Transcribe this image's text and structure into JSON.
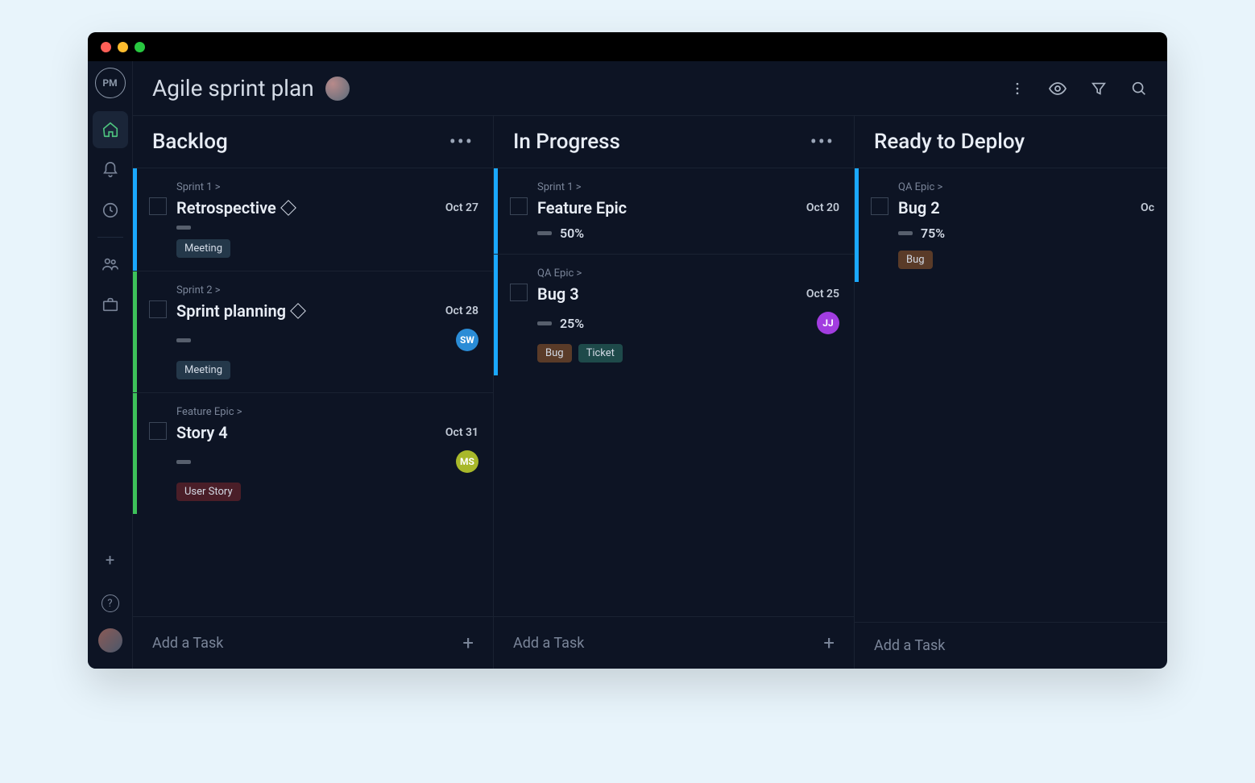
{
  "window": {
    "logo_text": "PM",
    "title": "Agile sprint plan"
  },
  "topbar_icons": {
    "more": "more-vertical-icon",
    "eye": "eye-icon",
    "filter": "filter-icon",
    "search": "search-icon"
  },
  "sidebar": {
    "items": [
      "home",
      "notifications",
      "recent",
      "people",
      "projects"
    ],
    "bottom": [
      "add",
      "help",
      "user-avatar"
    ]
  },
  "columns": [
    {
      "title": "Backlog",
      "show_more": true,
      "cards": [
        {
          "stripe": "blue",
          "breadcrumb": "Sprint 1 >",
          "title": "Retrospective",
          "has_diamond": true,
          "date": "Oct 27",
          "percent": "",
          "avatar": null,
          "tags": [
            {
              "label": "Meeting",
              "cls": "tag-meeting"
            }
          ]
        },
        {
          "stripe": "green",
          "breadcrumb": "Sprint 2 >",
          "title": "Sprint planning",
          "has_diamond": true,
          "date": "Oct 28",
          "percent": "",
          "avatar": {
            "text": "SW",
            "bg": "#2a8cd6"
          },
          "tags": [
            {
              "label": "Meeting",
              "cls": "tag-meeting"
            }
          ]
        },
        {
          "stripe": "green",
          "breadcrumb": "Feature Epic >",
          "title": "Story 4",
          "has_diamond": false,
          "date": "Oct 31",
          "percent": "",
          "avatar": {
            "text": "MS",
            "bg": "#a8b82a"
          },
          "tags": [
            {
              "label": "User Story",
              "cls": "tag-userstory"
            }
          ]
        }
      ],
      "add_task_label": "Add a Task",
      "show_add_plus": true
    },
    {
      "title": "In Progress",
      "show_more": true,
      "cards": [
        {
          "stripe": "blue",
          "breadcrumb": "Sprint 1 >",
          "title": "Feature Epic",
          "has_diamond": false,
          "date": "Oct 20",
          "percent": "50%",
          "avatar": null,
          "tags": []
        },
        {
          "stripe": "blue",
          "breadcrumb": "QA Epic >",
          "title": "Bug 3",
          "has_diamond": false,
          "date": "Oct 25",
          "percent": "25%",
          "avatar": {
            "text": "JJ",
            "bg": "#a23de0"
          },
          "tags": [
            {
              "label": "Bug",
              "cls": "tag-bug"
            },
            {
              "label": "Ticket",
              "cls": "tag-ticket"
            }
          ]
        }
      ],
      "add_task_label": "Add a Task",
      "show_add_plus": true
    },
    {
      "title": "Ready to Deploy",
      "show_more": false,
      "cards": [
        {
          "stripe": "blue",
          "breadcrumb": "QA Epic >",
          "title": "Bug 2",
          "has_diamond": false,
          "date": "Oc",
          "percent": "75%",
          "avatar": null,
          "tags": [
            {
              "label": "Bug",
              "cls": "tag-bug"
            }
          ]
        }
      ],
      "add_task_label": "Add a Task",
      "show_add_plus": false
    }
  ]
}
